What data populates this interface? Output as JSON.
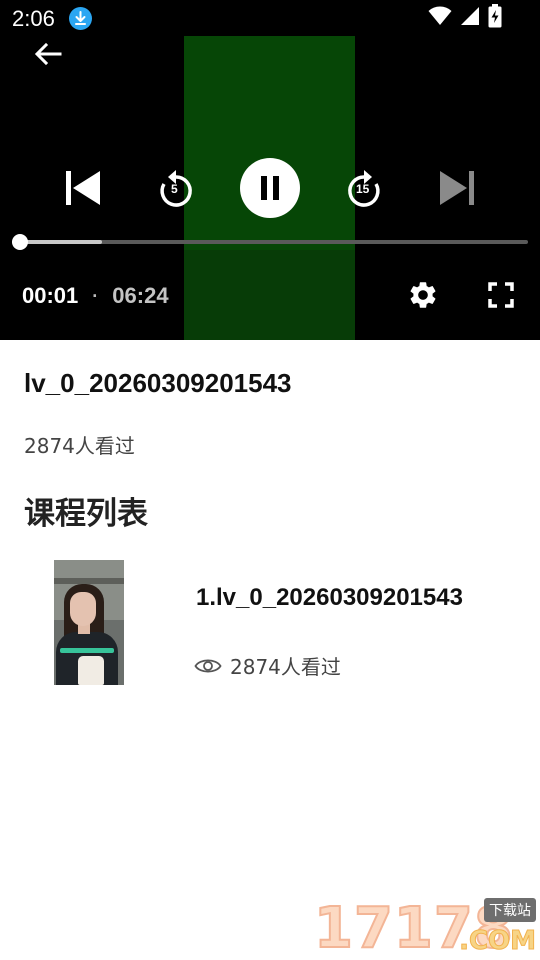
{
  "status_bar": {
    "time": "2:06",
    "icons": [
      "download-notification-icon",
      "wifi-icon",
      "cell-signal-icon",
      "battery-charging-icon"
    ]
  },
  "player": {
    "current_time": "00:01",
    "separator": "·",
    "total_time": "06:24",
    "progress_fraction": 0.0026,
    "buffered_fraction": 0.174,
    "is_playing": true,
    "rewind_seconds": "5",
    "forward_seconds": "15",
    "controls": [
      "back-icon",
      "skip-previous-icon",
      "rewind-icon",
      "pause-icon",
      "forward-icon",
      "skip-next-icon",
      "settings-icon",
      "fullscreen-icon"
    ],
    "colors": {
      "video_frame": "#064606",
      "progress_played": "#ffffff",
      "progress_track": "#5a5a5a"
    }
  },
  "video": {
    "title": "lv_0_20260309201543",
    "views": "2874人看过"
  },
  "course_list": {
    "heading": "课程列表",
    "items": [
      {
        "title": "1.lv_0_20260309201543",
        "views": "2874人看过"
      }
    ]
  },
  "watermark": {
    "digits": "17178",
    "tag": "下载站",
    "suffix": ".COM"
  }
}
